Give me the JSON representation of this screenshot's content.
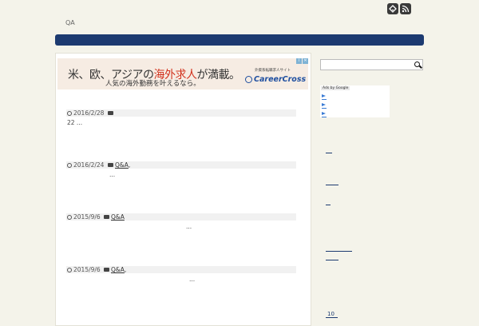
{
  "header": {
    "site_title": "QA",
    "icons": [
      "feedly-icon",
      "rss-icon"
    ],
    "nav_color": "#1c3a70"
  },
  "ad_banner": {
    "headline_a": "米、欧、アジアの",
    "headline_b": "海外求人",
    "headline_c": "が満載。",
    "sub": "人気の海外勤務を叶えるなら。",
    "site_label": "外資系転職求人サイト",
    "brand": "CareerCross",
    "accent": "#d2331e",
    "brand_color": "#1f4fa0"
  },
  "posts": [
    {
      "date": "2016/2/28",
      "category": "",
      "excerpt": "22 ..."
    },
    {
      "date": "2016/2/24",
      "category": "Q&A",
      "category_suffix": ",",
      "excerpt": "..."
    },
    {
      "date": "2015/9/6",
      "category": "Q&A",
      "category_suffix": "",
      "excerpt": "..."
    },
    {
      "date": "2015/9/6",
      "category": "Q&A",
      "category_suffix": ",",
      "excerpt": "..."
    }
  ],
  "sidebar": {
    "search": {
      "placeholder": ""
    },
    "ads_label": "Ads by Google",
    "number_link": "10"
  }
}
